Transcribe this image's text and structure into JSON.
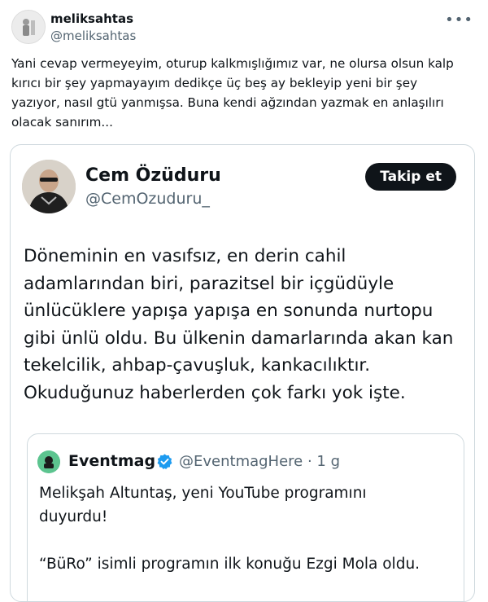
{
  "outer_tweet": {
    "display_name": "meliksahtas",
    "handle": "@meliksahtas",
    "more_icon": "more-horizontal-icon",
    "text": "Yani cevap vermeyeyim, oturup kalkmışlığımız var, ne olursa olsun kalp\nkırıcı bir şey yapmayayım dedikçe üç beş ay bekleyip yeni bir şey\nyazıyor, nasıl gtü yanmışsa. Buna kendi ağzından yazmak en anlaşılırı\nolacak sanırım..."
  },
  "embedded_tweet": {
    "display_name": "Cem Özüduru",
    "handle": "@CemOzuduru_",
    "follow_label": "Takip et",
    "text": "Döneminin en vasıfsız, en derin cahil\nadamlarından biri, parazitsel bir içgüdüyle\nünlücüklere yapışa yapışa en sonunda nurtopu\ngibi ünlü oldu. Bu ülkenin damarlarında akan kan\ntekelcilik, ahbap-çavuşluk, kankacılıktır.\nOkuduğunuz haberlerden çok farkı yok işte."
  },
  "quoted_tweet": {
    "display_name": "Eventmag",
    "verified_icon": "verified-badge-icon",
    "handle_time": "@EventmagHere · 1 g",
    "text": "Melikşah Altuntaş, yeni YouTube programını\nduyurdu!\n\n“BüRo” isimli programın ilk konuğu Ezgi Mola oldu."
  },
  "colors": {
    "text_primary": "#0f1419",
    "text_secondary": "#536471",
    "border": "#cfd9de",
    "verified_blue": "#1d9bf0",
    "button_bg": "#0f1419"
  }
}
